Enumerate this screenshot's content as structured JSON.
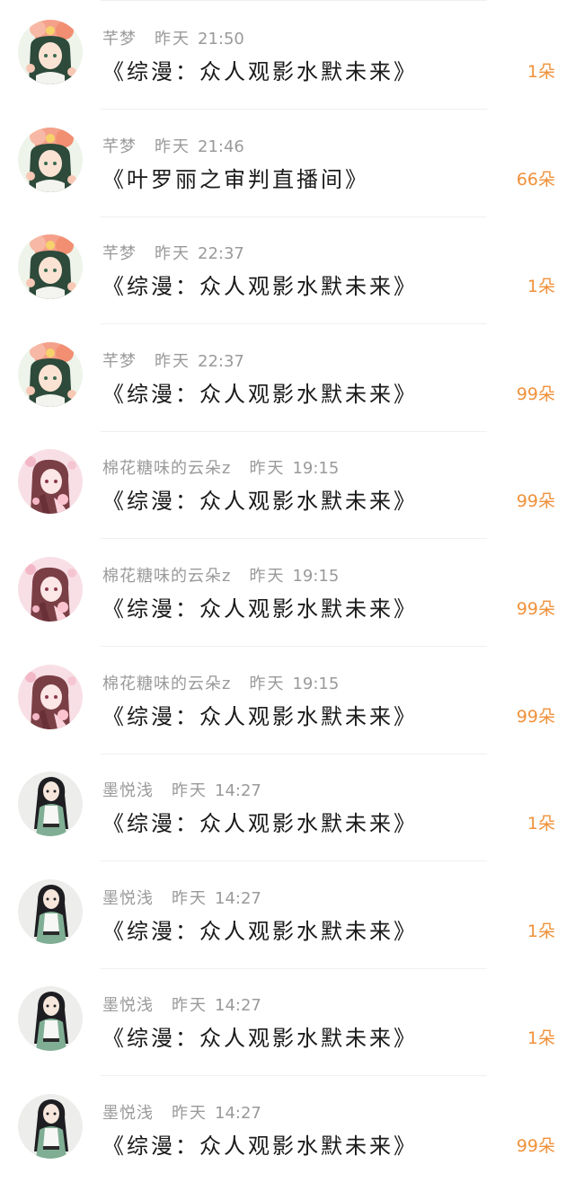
{
  "rows": [
    {
      "user": "芊梦",
      "day": "昨天",
      "time": "21:50",
      "title": "《综漫：众人观影水默未来》",
      "gift": "1朵",
      "avatar": "flower-girl-avatar"
    },
    {
      "user": "芊梦",
      "day": "昨天",
      "time": "21:46",
      "title": "《叶罗丽之审判直播间》",
      "gift": "66朵",
      "avatar": "flower-girl-avatar"
    },
    {
      "user": "芊梦",
      "day": "昨天",
      "time": "22:37",
      "title": "《综漫：众人观影水默未来》",
      "gift": "1朵",
      "avatar": "flower-girl-avatar"
    },
    {
      "user": "芊梦",
      "day": "昨天",
      "time": "22:37",
      "title": "《综漫：众人观影水默未来》",
      "gift": "99朵",
      "avatar": "flower-girl-avatar"
    },
    {
      "user": "棉花糖味的云朵z",
      "day": "昨天",
      "time": "19:15",
      "title": "《综漫：众人观影水默未来》",
      "gift": "99朵",
      "avatar": "pink-girl-avatar"
    },
    {
      "user": "棉花糖味的云朵z",
      "day": "昨天",
      "time": "19:15",
      "title": "《综漫：众人观影水默未来》",
      "gift": "99朵",
      "avatar": "pink-girl-avatar"
    },
    {
      "user": "棉花糖味的云朵z",
      "day": "昨天",
      "time": "19:15",
      "title": "《综漫：众人观影水默未来》",
      "gift": "99朵",
      "avatar": "pink-girl-avatar"
    },
    {
      "user": "墨悦浅",
      "day": "昨天",
      "time": "14:27",
      "title": "《综漫：众人观影水默未来》",
      "gift": "1朵",
      "avatar": "dark-hair-girl-avatar"
    },
    {
      "user": "墨悦浅",
      "day": "昨天",
      "time": "14:27",
      "title": "《综漫：众人观影水默未来》",
      "gift": "1朵",
      "avatar": "dark-hair-girl-avatar"
    },
    {
      "user": "墨悦浅",
      "day": "昨天",
      "time": "14:27",
      "title": "《综漫：众人观影水默未来》",
      "gift": "1朵",
      "avatar": "dark-hair-girl-avatar"
    },
    {
      "user": "墨悦浅",
      "day": "昨天",
      "time": "14:27",
      "title": "《综漫：众人观影水默未来》",
      "gift": "99朵",
      "avatar": "dark-hair-girl-avatar"
    }
  ],
  "colors": {
    "meta": "#9a9a9a",
    "title": "#1a1a1a",
    "gift": "#f0913a",
    "divider": "#f0f0f0"
  }
}
